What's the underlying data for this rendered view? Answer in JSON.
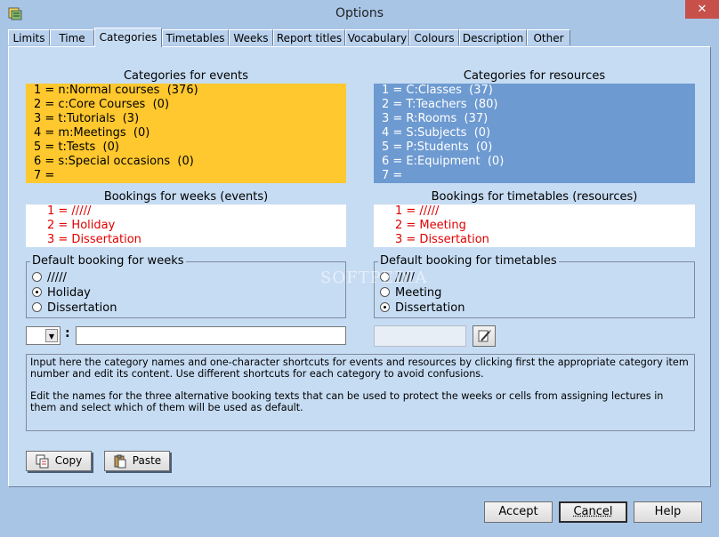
{
  "window": {
    "title": "Options",
    "close_label": "✕"
  },
  "tabs": [
    {
      "label": "Limits"
    },
    {
      "label": "Time"
    },
    {
      "label": "Categories",
      "active": true
    },
    {
      "label": "Timetables"
    },
    {
      "label": "Weeks"
    },
    {
      "label": "Report titles"
    },
    {
      "label": "Vocabulary"
    },
    {
      "label": "Colours"
    },
    {
      "label": "Description"
    },
    {
      "label": "Other"
    }
  ],
  "events": {
    "heading": "Categories for events",
    "items": [
      "1 = n:Normal courses  (376)",
      "2 = c:Core Courses  (0)",
      "3 = t:Tutorials  (3)",
      "4 = m:Meetings  (0)",
      "5 = t:Tests  (0)",
      "6 = s:Special occasions  (0)",
      "7 = "
    ]
  },
  "resources": {
    "heading": "Categories for resources",
    "items": [
      "1 = C:Classes  (37)",
      "2 = T:Teachers  (80)",
      "3 = R:Rooms  (37)",
      "4 = S:Subjects  (0)",
      "5 = P:Students  (0)",
      "6 = E:Equipment  (0)",
      "7 = "
    ]
  },
  "bookings_weeks": {
    "heading": "Bookings for weeks (events)",
    "items": [
      "1 = /////",
      "2 = Holiday",
      "3 = Dissertation"
    ]
  },
  "bookings_timetables": {
    "heading": "Bookings for timetables (resources)",
    "items": [
      "1 = /////",
      "2 = Meeting",
      "3 = Dissertation"
    ]
  },
  "default_weeks": {
    "title": "Default booking for weeks",
    "options": [
      "/////",
      "Holiday",
      "Dissertation"
    ],
    "selected": 1
  },
  "default_timetables": {
    "title": "Default booking for timetables",
    "options": [
      "/////",
      "Meeting",
      "Dissertation"
    ],
    "selected": 2
  },
  "editor": {
    "colon": ":",
    "combo_value": "",
    "name_value": ""
  },
  "info": {
    "para1": "Input here the category names and one-character shortcuts for events and resources by clicking first the appropriate category item number and edit its content. Use different shortcuts for each category to avoid confusions.",
    "para2": "Edit the names for the three alternative booking texts that can be used to protect the weeks or cells from assigning lectures in them and select which of them will be used as default."
  },
  "buttons": {
    "copy": "Copy",
    "paste": "Paste",
    "accept": "Accept",
    "cancel": "Cancel",
    "help": "Help"
  },
  "watermark": "SOFTPEDIA",
  "colors": {
    "events_bg": "#ffc82e",
    "resources_bg": "#6d9ad1",
    "booking_text": "#e00000",
    "panel_bg": "#c6dcf3",
    "window_bg": "#a9c5e6"
  }
}
